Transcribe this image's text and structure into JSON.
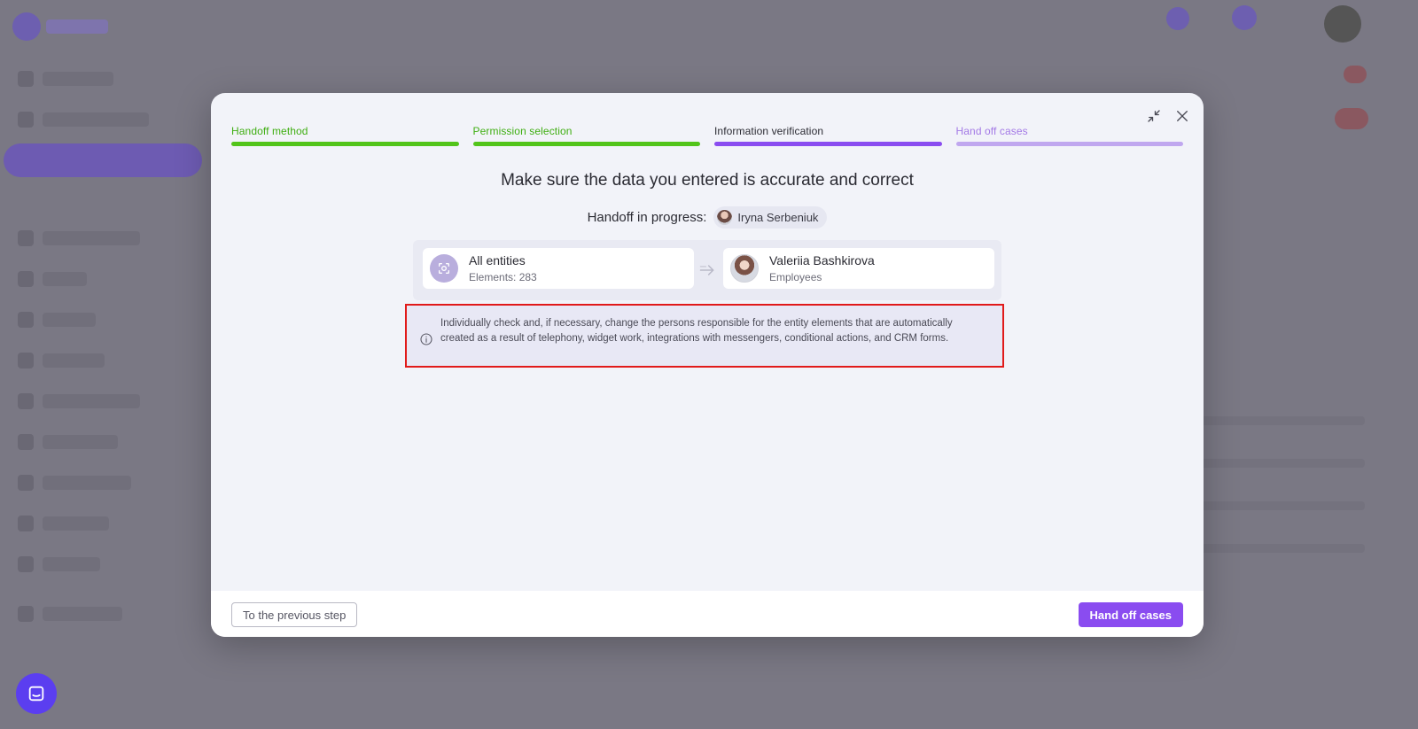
{
  "steps": [
    {
      "label": "Handoff method",
      "state": "done"
    },
    {
      "label": "Permission selection",
      "state": "done"
    },
    {
      "label": "Information verification",
      "state": "current"
    },
    {
      "label": "Hand off cases",
      "state": "pending"
    }
  ],
  "headline": "Make sure the data you entered is accurate and correct",
  "progress": {
    "label": "Handoff in progress:",
    "person": "Iryna Serbeniuk"
  },
  "transfer": {
    "source": {
      "title": "All entities",
      "subtitle": "Elements: 283",
      "icon": "entities-icon"
    },
    "target": {
      "title": "Valeriia Bashkirova",
      "subtitle": "Employees",
      "icon": "user-avatar"
    }
  },
  "notice": {
    "icon": "info-icon",
    "text": "Individually check and, if necessary, change the persons responsible for the entity elements that are automatically created as a result of telephony, widget work, integrations with messengers, conditional actions, and CRM forms."
  },
  "footer": {
    "back_label": "To the previous step",
    "submit_label": "Hand off cases"
  },
  "colors": {
    "accent": "#8a4cf0",
    "done": "#52c41a",
    "pending": "#c0a7ef",
    "highlight_border": "#e11a1a"
  }
}
